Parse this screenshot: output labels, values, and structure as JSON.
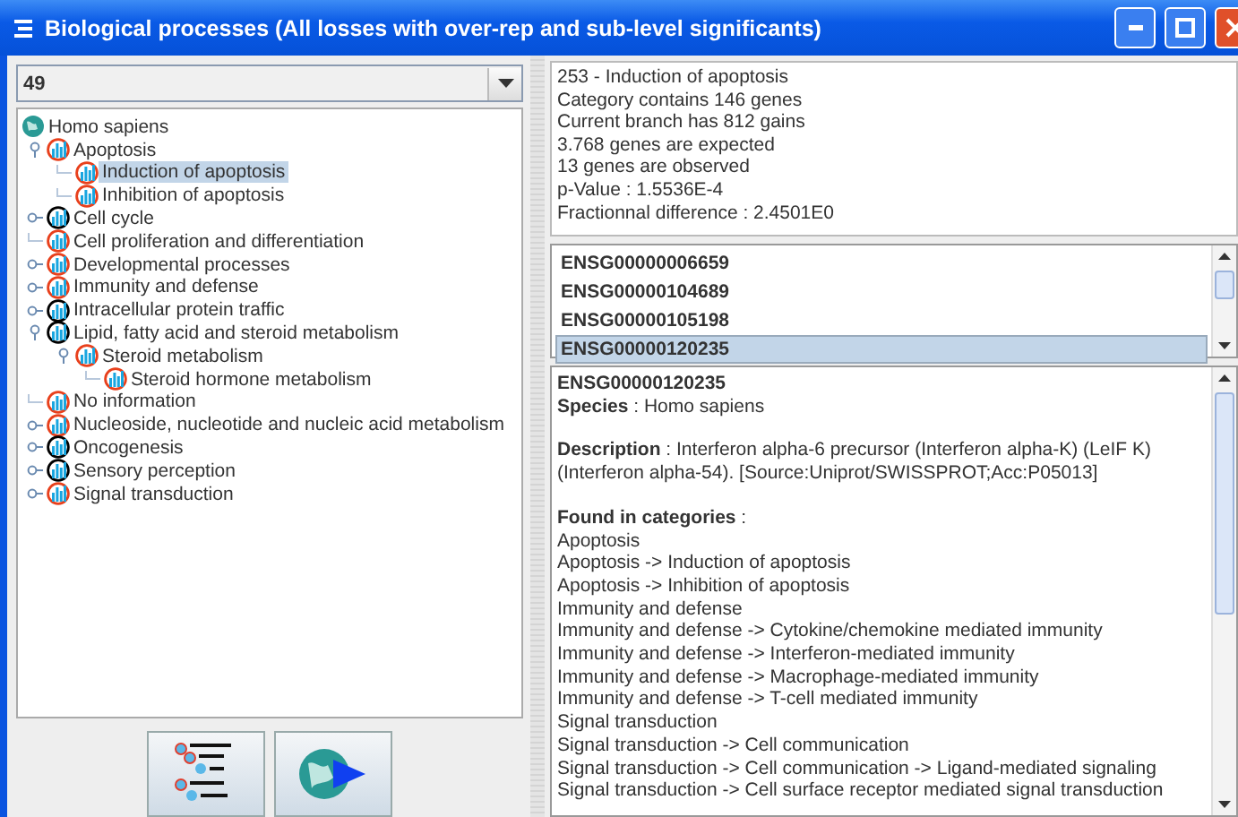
{
  "window": {
    "title": "Biological processes (All losses with over-rep and sub-level significants)"
  },
  "combo": {
    "value": "49"
  },
  "tree": {
    "root": "Homo sapiens",
    "items": [
      {
        "label": "Apoptosis",
        "kind": "branch",
        "expanded": true,
        "color": "#e8401c",
        "selected": false,
        "children": [
          {
            "label": "Induction of apoptosis",
            "kind": "leaf",
            "color": "#e8401c",
            "selected": true
          },
          {
            "label": "Inhibition of apoptosis",
            "kind": "leaf",
            "color": "#e8401c",
            "selected": false
          }
        ]
      },
      {
        "label": "Cell cycle",
        "kind": "branch",
        "expanded": false,
        "color": "#000000",
        "selected": false
      },
      {
        "label": "Cell proliferation and differentiation",
        "kind": "leaf",
        "color": "#e8401c",
        "selected": false
      },
      {
        "label": "Developmental processes",
        "kind": "branch",
        "expanded": false,
        "color": "#e8401c",
        "selected": false
      },
      {
        "label": "Immunity and defense",
        "kind": "branch",
        "expanded": false,
        "color": "#e8401c",
        "selected": false
      },
      {
        "label": "Intracellular protein traffic",
        "kind": "branch",
        "expanded": false,
        "color": "#000000",
        "selected": false
      },
      {
        "label": "Lipid, fatty acid and steroid metabolism",
        "kind": "branch",
        "expanded": true,
        "color": "#000000",
        "selected": false,
        "children": [
          {
            "label": "Steroid metabolism",
            "kind": "branch",
            "expanded": true,
            "color": "#e8401c",
            "selected": false,
            "children": [
              {
                "label": "Steroid hormone metabolism",
                "kind": "leaf",
                "color": "#e8401c",
                "selected": false
              }
            ]
          }
        ]
      },
      {
        "label": "No information",
        "kind": "leaf",
        "color": "#e8401c",
        "selected": false
      },
      {
        "label": "Nucleoside, nucleotide and nucleic acid metabolism",
        "kind": "branch",
        "expanded": false,
        "color": "#e8401c",
        "selected": false
      },
      {
        "label": "Oncogenesis",
        "kind": "branch",
        "expanded": false,
        "color": "#000000",
        "selected": false
      },
      {
        "label": "Sensory perception",
        "kind": "branch",
        "expanded": false,
        "color": "#000000",
        "selected": false
      },
      {
        "label": "Signal transduction",
        "kind": "branch",
        "expanded": false,
        "color": "#e8401c",
        "selected": false
      }
    ]
  },
  "info": [
    "253 - Induction of apoptosis",
    "Category contains 146 genes",
    "Current branch has 812 gains",
    "3.768 genes are expected",
    "13 genes are observed",
    "p-Value : 1.5536E-4",
    "Fractionnal difference : 2.4501E0"
  ],
  "genes": [
    {
      "id": "ENSG00000006659",
      "selected": false
    },
    {
      "id": "ENSG00000104689",
      "selected": false
    },
    {
      "id": "ENSG00000105198",
      "selected": false
    },
    {
      "id": "ENSG00000120235",
      "selected": true
    }
  ],
  "detail": {
    "gene": "ENSG00000120235",
    "species": "**Species** : Homo sapiens",
    "description": "**Description** : Interferon alpha-6 precursor (Interferon alpha-K) (LeIF K) (Interferon alpha-54). [Source:Uniprot/SWISSPROT;Acc:P05013]",
    "categories_heading": "**Found in categories** :",
    "categories": [
      "Apoptosis",
      "Apoptosis -> Induction of apoptosis",
      "Apoptosis -> Inhibition of apoptosis",
      "Immunity and defense",
      "Immunity and defense -> Cytokine/chemokine mediated immunity",
      "Immunity and defense -> Interferon-mediated immunity",
      "Immunity and defense -> Macrophage-mediated immunity",
      "Immunity and defense -> T-cell mediated immunity",
      "Signal transduction",
      "Signal transduction -> Cell communication",
      "Signal transduction -> Cell communication -> Ligand-mediated signaling",
      "Signal transduction -> Cell surface receptor mediated signal transduction"
    ]
  }
}
